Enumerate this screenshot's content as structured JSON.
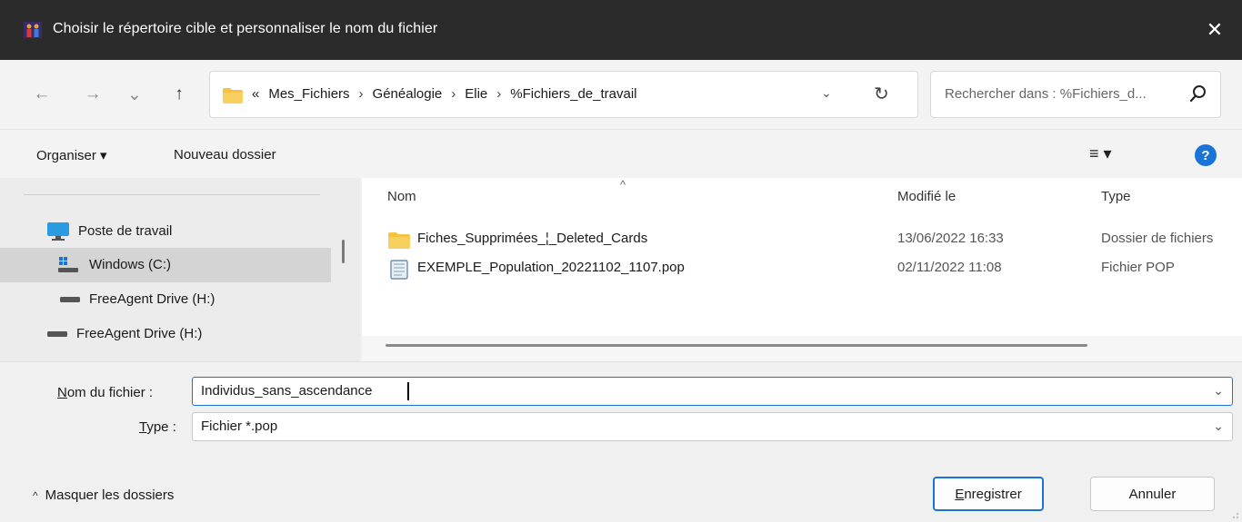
{
  "window": {
    "title": "Choisir le répertoire cible et personnaliser le nom du fichier",
    "close": "✕"
  },
  "nav": {
    "back": "←",
    "forward": "→",
    "recent": "⌄",
    "up": "↑"
  },
  "address": {
    "prefix": "«",
    "crumbs": [
      "Mes_Fichiers",
      "Généalogie",
      "Elie",
      "%Fichiers_de_travail"
    ],
    "separator": "›",
    "dropdown": "⌄",
    "refresh": "↻"
  },
  "search": {
    "placeholder": "Rechercher dans : %Fichiers_d..."
  },
  "toolbar": {
    "organize": "Organiser ▾",
    "new_folder": "Nouveau dossier",
    "view": "≡ ▾",
    "help": "?"
  },
  "sidebar": {
    "items": [
      {
        "label": "Poste de travail"
      },
      {
        "label": "Windows  (C:)"
      },
      {
        "label": "FreeAgent Drive (H:)"
      },
      {
        "label": "FreeAgent Drive (H:)"
      }
    ]
  },
  "files": {
    "sort_indicator": "^",
    "columns": {
      "name": "Nom",
      "modified": "Modifié le",
      "type": "Type"
    },
    "rows": [
      {
        "name": "Fiches_Supprimées_¦_Deleted_Cards",
        "modified": "13/06/2022 16:33",
        "type": "Dossier de fichiers"
      },
      {
        "name": "EXEMPLE_Population_20221102_1107.pop",
        "modified": "02/11/2022 11:08",
        "type": "Fichier POP"
      }
    ]
  },
  "form": {
    "filename_label_u": "N",
    "filename_label_rest": "om du fichier :",
    "filename_value": "Individus_sans_ascendance",
    "type_label_u": "T",
    "type_label_rest": "ype :",
    "type_value": "Fichier *.pop",
    "chevron": "⌄"
  },
  "footer": {
    "hide_arrow": "^",
    "hide_folders": "Masquer les dossiers",
    "save_u": "E",
    "save_rest": "nregistrer",
    "cancel": "Annuler"
  },
  "colors": {
    "accent": "#1a74d8",
    "titlebar": "#2b2b2b",
    "folder": "#f5c342"
  }
}
